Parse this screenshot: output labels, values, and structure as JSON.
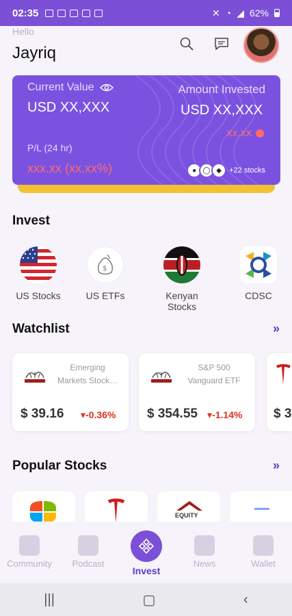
{
  "status": {
    "time": "02:35",
    "battery": "62%"
  },
  "header": {
    "greeting": "Hello",
    "username": "Jayriq"
  },
  "portfolio": {
    "current_value_label": "Current Value",
    "current_value": "USD XX,XXX",
    "amount_invested_label": "Amount Invested",
    "amount_invested": "USD XX,XXX",
    "invested_change": "xx.xx",
    "pl_label": "P/L (24 hr)",
    "pl_value": "xxx.xx (xx.xx%)",
    "more_stocks": "+22 stocks"
  },
  "invest": {
    "title": "Invest",
    "items": [
      {
        "label": "US Stocks"
      },
      {
        "label": "US ETFs"
      },
      {
        "label": "Kenyan Stocks"
      },
      {
        "label": "CDSC"
      }
    ]
  },
  "watchlist": {
    "title": "Watchlist",
    "more": "»",
    "items": [
      {
        "name_line1": "Emerging",
        "name_line2": "Markets Stock…",
        "price": "$ 39.16",
        "change": "-0.36%"
      },
      {
        "name_line1": "S&P 500",
        "name_line2": "Vanguard ETF",
        "price": "$ 354.55",
        "change": "-1.14%"
      },
      {
        "price": "$ 3"
      }
    ]
  },
  "popular": {
    "title": "Popular Stocks",
    "more": "»",
    "equity_label": "EQUITY"
  },
  "nav": {
    "items": [
      {
        "label": "Community"
      },
      {
        "label": "Podcast"
      },
      {
        "label": "Invest"
      },
      {
        "label": "News"
      },
      {
        "label": "Wallet"
      }
    ]
  },
  "colors": {
    "primary": "#7b4fd6",
    "card": "#7b52e0",
    "negative": "#e0301e",
    "accent_yellow": "#f2c230"
  }
}
